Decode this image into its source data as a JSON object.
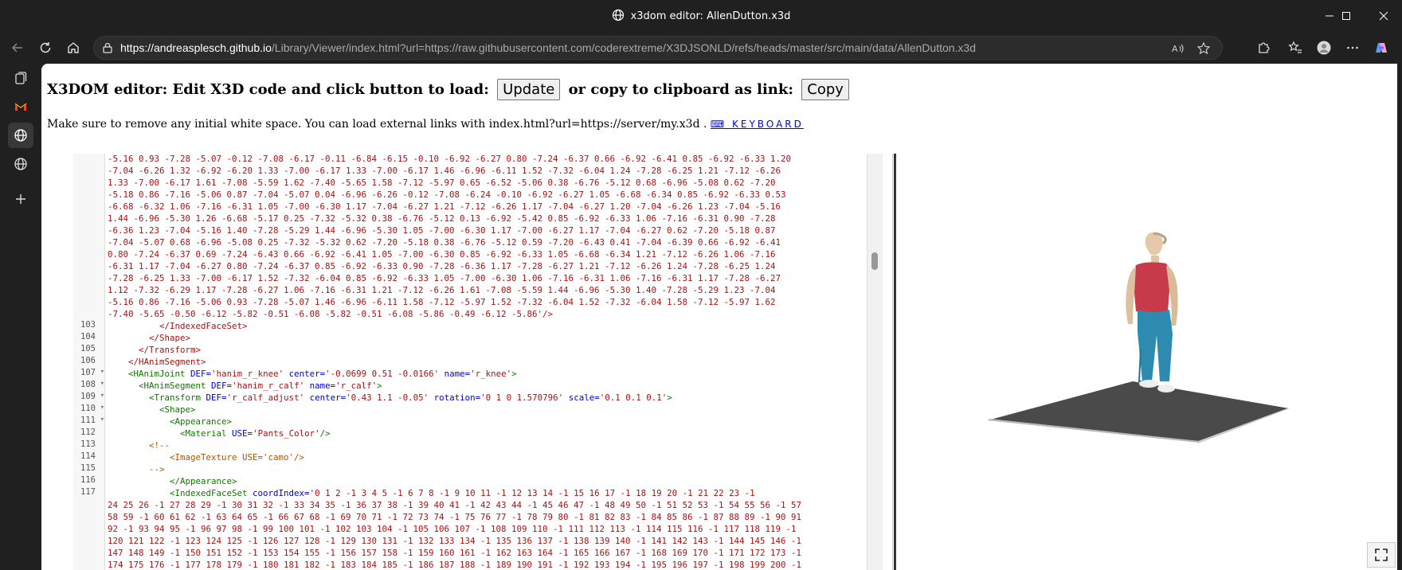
{
  "window": {
    "title": "x3dom editor: AllenDutton.x3d"
  },
  "browser": {
    "url_host": "https://andreasplesch.github.io",
    "url_rest": "/Library/Viewer/index.html?url=https://raw.githubusercontent.com/coderextreme/X3DJSONLD/refs/heads/master/src/main/data/AllenDutton.x3d"
  },
  "page": {
    "heading_text_1": "X3DOM editor: Edit X3D code and click button to load:",
    "update_label": "Update",
    "heading_text_2": "or copy to clipboard as link:",
    "copy_label": "Copy",
    "note_text": "Make sure to remove any initial white space. You can load external links with index.html?url=https://server/my.x3d .",
    "keyboard_link": "⌨ KEYBOARD"
  },
  "editor": {
    "numbers_prefix_lines": [
      "-5.16 0.93 -7.28 -5.07 -0.12 -7.08 -6.17 -0.11 -6.84 -6.15 -0.10 -6.92 -6.27 0.80 -7.24 -6.37 0.66 -6.92 -6.41 0.85 -6.92 -6.33 1.20",
      "-7.04 -6.26 1.32 -6.92 -6.20 1.33 -7.00 -6.17 1.33 -7.00 -6.17 1.46 -6.96 -6.11 1.52 -7.32 -6.04 1.24 -7.28 -6.25 1.21 -7.12 -6.26",
      "1.33 -7.00 -6.17 1.61 -7.08 -5.59 1.62 -7.40 -5.65 1.58 -7.12 -5.97 0.65 -6.52 -5.06 0.38 -6.76 -5.12 0.68 -6.96 -5.08 0.62 -7.20",
      "-5.18 0.86 -7.16 -5.06 0.87 -7.04 -5.07 0.04 -6.96 -6.26 -0.12 -7.08 -6.24 -0.10 -6.92 -6.27 1.05 -6.68 -6.34 0.85 -6.92 -6.33 0.53",
      "-6.68 -6.32 1.06 -7.16 -6.31 1.05 -7.00 -6.30 1.17 -7.04 -6.27 1.21 -7.12 -6.26 1.17 -7.04 -6.27 1.20 -7.04 -6.26 1.23 -7.04 -5.16",
      "1.44 -6.96 -5.30 1.26 -6.68 -5.17 0.25 -7.32 -5.32 0.38 -6.76 -5.12 0.13 -6.92 -5.42 0.85 -6.92 -6.33 1.06 -7.16 -6.31 0.90 -7.28",
      "-6.36 1.23 -7.04 -5.16 1.40 -7.28 -5.29 1.44 -6.96 -5.30 1.05 -7.00 -6.30 1.17 -7.00 -6.27 1.17 -7.04 -6.27 0.62 -7.20 -5.18 0.87",
      "-7.04 -5.07 0.68 -6.96 -5.08 0.25 -7.32 -5.32 0.62 -7.20 -5.18 0.38 -6.76 -5.12 0.59 -7.20 -6.43 0.41 -7.04 -6.39 0.66 -6.92 -6.41",
      "0.80 -7.24 -6.37 0.69 -7.24 -6.43 0.66 -6.92 -6.41 1.05 -7.00 -6.30 0.85 -6.92 -6.33 1.05 -6.68 -6.34 1.21 -7.12 -6.26 1.06 -7.16",
      "-6.31 1.17 -7.04 -6.27 0.80 -7.24 -6.37 0.85 -6.92 -6.33 0.90 -7.28 -6.36 1.17 -7.28 -6.27 1.21 -7.12 -6.26 1.24 -7.28 -6.25 1.24",
      "-7.28 -6.25 1.33 -7.00 -6.17 1.52 -7.32 -6.04 0.85 -6.92 -6.33 1.05 -7.00 -6.30 1.06 -7.16 -6.31 1.06 -7.16 -6.31 1.17 -7.28 -6.27",
      "1.12 -7.32 -6.29 1.17 -7.28 -6.27 1.06 -7.16 -6.31 1.21 -7.12 -6.26 1.61 -7.08 -5.59 1.44 -6.96 -5.30 1.40 -7.28 -5.29 1.23 -7.04",
      "-5.16 0.86 -7.16 -5.06 0.93 -7.28 -5.07 1.46 -6.96 -6.11 1.58 -7.12 -5.97 1.52 -7.32 -6.04 1.52 -7.32 -6.04 1.58 -7.12 -5.97 1.62",
      "-7.40 -5.65 -0.50 -6.12 -5.82 -0.51 -6.08 -5.82 -0.51 -6.08 -5.86 -0.49 -6.12 -5.86'/>"
    ],
    "line_103": "</IndexedFaceSet>",
    "line_104": "</Shape>",
    "line_105": "</Transform>",
    "line_106": "</HAnimSegment>",
    "line_107": {
      "tag": "<HAnimJoint",
      "a1": "DEF=",
      "v1": "'hanim_r_knee'",
      "a2": "center=",
      "v2": "'-0.0699 0.51 -0.0166'",
      "a3": "name=",
      "v3": "'r_knee'",
      "end": ">"
    },
    "line_108": {
      "tag": "<HAnimSegment",
      "a1": "DEF=",
      "v1": "'hanim_r_calf'",
      "a2": "name=",
      "v2": "'r_calf'",
      "end": ">"
    },
    "line_109": {
      "tag": "<Transform",
      "a1": "DEF=",
      "v1": "'r_calf_adjust'",
      "a2": "center=",
      "v2": "'0.43 1.1 -0.05'",
      "a3": "rotation=",
      "v3": "'0 1 0 1.570796'",
      "a4": "scale=",
      "v4": "'0.1 0.1 0.1'",
      "end": ">"
    },
    "line_110": "<Shape>",
    "line_111": "<Appearance>",
    "line_112": {
      "tag": "<Material",
      "a1": "USE=",
      "v1": "'Pants_Color'",
      "end": "/>"
    },
    "line_113": "<!--",
    "line_114": "<ImageTexture USE='camo'/>",
    "line_115": "-->",
    "line_116": "</Appearance>",
    "line_117": {
      "tag": "<IndexedFaceSet",
      "a1": "coordIndex=",
      "v1": "'0 1 2 -1 3 4 5 -1 6 7 8 -1 9 10 11 -1 12 13 14 -1 15 16 17 -1 18 19 20 -1 21 22 23 -1"
    },
    "index_lines": [
      "24 25 26 -1 27 28 29 -1 30 31 32 -1 33 34 35 -1 36 37 38 -1 39 40 41 -1 42 43 44 -1 45 46 47 -1 48 49 50 -1 51 52 53 -1 54 55 56 -1 57",
      "58 59 -1 60 61 62 -1 63 64 65 -1 66 67 68 -1 69 70 71 -1 72 73 74 -1 75 76 77 -1 78 79 80 -1 81 82 83 -1 84 85 86 -1 87 88 89 -1 90 91",
      "92 -1 93 94 95 -1 96 97 98 -1 99 100 101 -1 102 103 104 -1 105 106 107 -1 108 109 110 -1 111 112 113 -1 114 115 116 -1 117 118 119 -1",
      "120 121 122 -1 123 124 125 -1 126 127 128 -1 129 130 131 -1 132 133 134 -1 135 136 137 -1 138 139 140 -1 141 142 143 -1 144 145 146 -1",
      "147 148 149 -1 150 151 152 -1 153 154 155 -1 156 157 158 -1 159 160 161 -1 162 163 164 -1 165 166 167 -1 168 169 170 -1 171 172 173 -1",
      "174 175 176 -1 177 178 179 -1 180 181 182 -1 183 184 185 -1 186 187 188 -1 189 190 191 -1 192 193 194 -1 195 196 197 -1 198 199 200 -1"
    ],
    "line_numbers": [
      "103",
      "104",
      "105",
      "106",
      "107",
      "108",
      "109",
      "110",
      "111",
      "112",
      "113",
      "114",
      "115",
      "116",
      "117"
    ]
  }
}
